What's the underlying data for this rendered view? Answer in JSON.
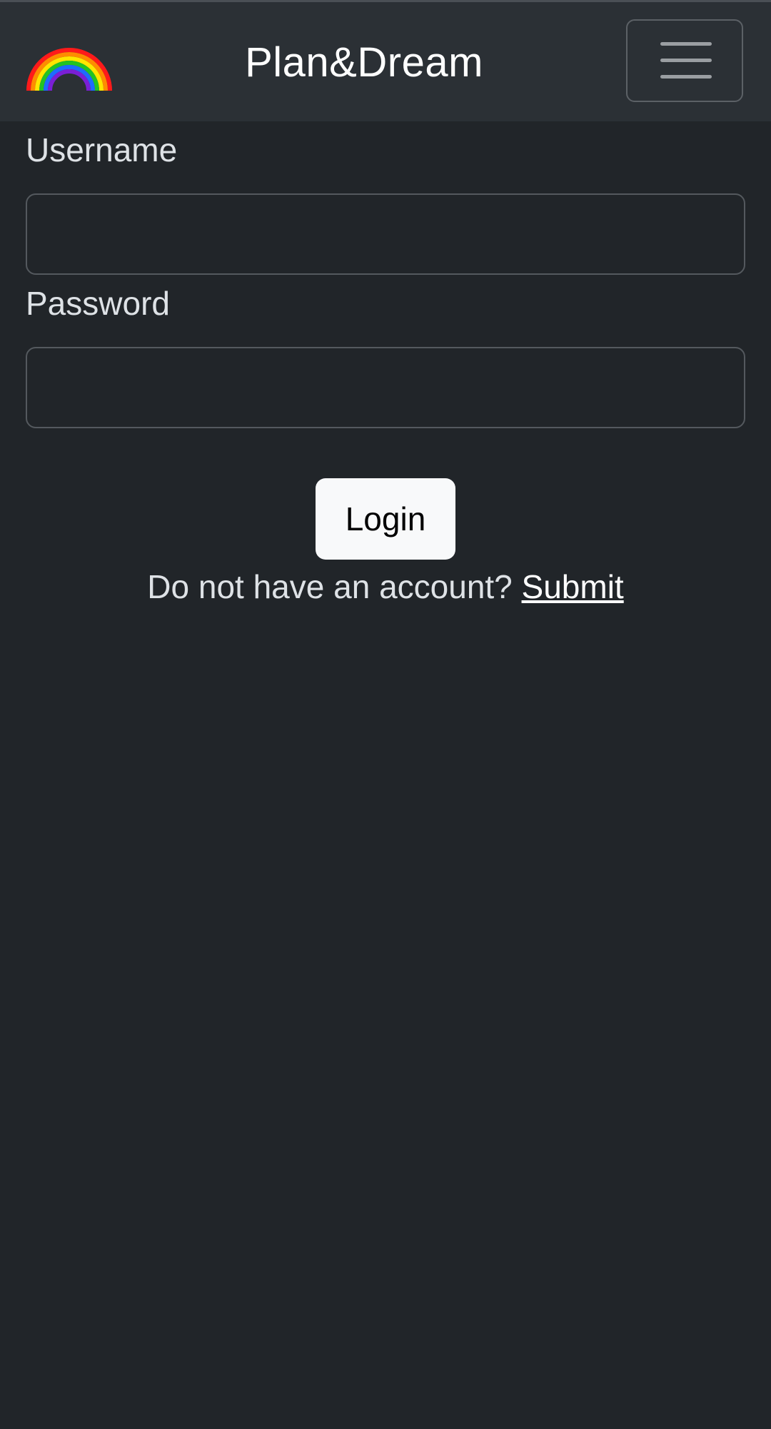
{
  "header": {
    "brand_title": "Plan&Dream",
    "logo": "rainbow-logo",
    "menu_icon": "hamburger-menu-icon"
  },
  "form": {
    "username_label": "Username",
    "username_value": "",
    "password_label": "Password",
    "password_value": "",
    "login_label": "Login"
  },
  "signup": {
    "prompt": "Do not have an account?",
    "link_label": "Submit"
  },
  "colors": {
    "background": "#212529",
    "navbar": "#2b3035",
    "button_bg": "#f8f9fa",
    "text": "#dee2e6"
  }
}
